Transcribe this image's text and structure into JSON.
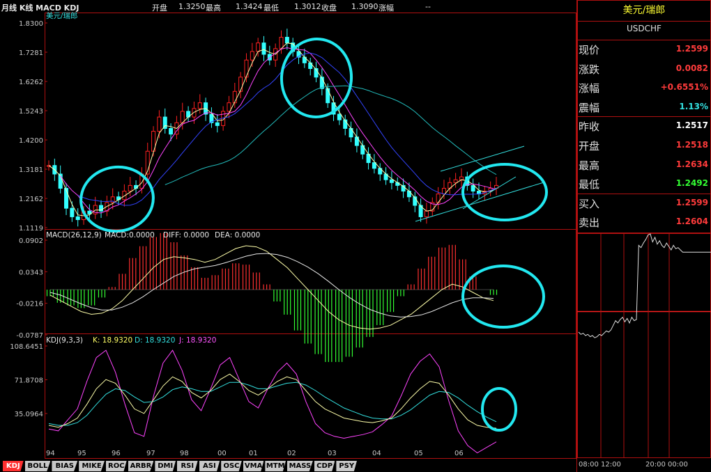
{
  "header": {
    "title": "月线 K线 MACD KDJ",
    "open_label": "开盘",
    "open_value": "1.3250",
    "high_label": "最高",
    "high_value": "1.3424",
    "low_label": "最低",
    "low_value": "1.3012",
    "close_label": "收盘",
    "close_value": "1.3090",
    "change_label": "涨幅",
    "change_value": "--"
  },
  "main_panel": {
    "symbol_label": "美元/瑞郎",
    "y_ticks": [
      "1.8300",
      "1.7281",
      "1.6262",
      "1.5243",
      "1.4200",
      "1.3181",
      "1.2162",
      "1.1119"
    ]
  },
  "macd_panel": {
    "title": "MACD(26,12,9)",
    "macd_label": "MACD:0.0000",
    "diff_label": "DIFF: 0.0000",
    "dea_label": "DEA: 0.0000",
    "y_ticks": [
      "0.0902",
      "0.0343",
      "-0.0216",
      "-0.0787"
    ]
  },
  "kdj_panel": {
    "title": "KDJ(9,3,3)",
    "k_label": "K: 18.9320",
    "d_label": "D: 18.9320",
    "j_label": "J: 18.9320",
    "y_ticks": [
      "108.6451",
      "71.8708",
      "35.0964"
    ]
  },
  "x_ticks": [
    "94",
    "95",
    "96",
    "97",
    "98",
    "00",
    "01",
    "02",
    "03",
    "04",
    "05",
    "06"
  ],
  "bottom_tabs": [
    "KDJ",
    "BOLL",
    "BIAS",
    "MIKE",
    "ROC",
    "ARBR",
    "DMI",
    "RSI",
    "ASI",
    "OSC",
    "VMA",
    "MTM",
    "MASS",
    "CDP",
    "PSY"
  ],
  "active_tab": "KDJ",
  "quote": {
    "name": "美元/瑞郎",
    "code": "USDCHF",
    "rows": [
      {
        "label": "现价",
        "value": "1.2599",
        "color": "#ff3b3b"
      },
      {
        "label": "涨跌",
        "value": "0.0082",
        "color": "#ff3b3b"
      },
      {
        "label": "涨幅",
        "value": "+0.6551%",
        "color": "#ff3b3b"
      },
      {
        "label": "震幅",
        "value": "1.13%",
        "color": "#33e0e0"
      },
      {
        "label": "昨收",
        "value": "1.2517",
        "color": "#ffffff"
      },
      {
        "label": "开盘",
        "value": "1.2518",
        "color": "#ff3b3b"
      },
      {
        "label": "最高",
        "value": "1.2634",
        "color": "#ff3b3b"
      },
      {
        "label": "最低",
        "value": "1.2492",
        "color": "#33ff33"
      },
      {
        "label": "买入",
        "value": "1.2599",
        "color": "#ff3b3b"
      },
      {
        "label": "卖出",
        "value": "1.2604",
        "color": "#ff3b3b"
      }
    ]
  },
  "intraday": {
    "time_start": "08:00",
    "time_mid1": "12:00",
    "time_mid2": "20:00",
    "time_end": "00:00",
    "ref_level": 0.32,
    "series": [
      0.14,
      0.12,
      0.13,
      0.11,
      0.12,
      0.1,
      0.11,
      0.09,
      0.1,
      0.12,
      0.11,
      0.13,
      0.15,
      0.14,
      0.16,
      0.2,
      0.24,
      0.22,
      0.25,
      0.27,
      0.23,
      0.26,
      0.22,
      0.27,
      0.24,
      0.25,
      0.9,
      0.88,
      0.92,
      0.95,
      0.99,
      1.0,
      0.93,
      0.97,
      0.91,
      0.94,
      0.9,
      0.88,
      0.92,
      0.89,
      0.86,
      0.9,
      0.87,
      0.88,
      0.86,
      0.84,
      0.84,
      0.84,
      0.84,
      0.84,
      0.84
    ]
  },
  "chart_data": {
    "type": "candlestick",
    "price_range": [
      1.1119,
      1.83
    ],
    "price_series": [
      1.33,
      1.3,
      1.25,
      1.18,
      1.15,
      1.14,
      1.17,
      1.16,
      1.19,
      1.17,
      1.2,
      1.22,
      1.21,
      1.24,
      1.26,
      1.25,
      1.3,
      1.38,
      1.45,
      1.5,
      1.46,
      1.44,
      1.48,
      1.52,
      1.5,
      1.53,
      1.55,
      1.51,
      1.48,
      1.47,
      1.52,
      1.55,
      1.59,
      1.64,
      1.7,
      1.73,
      1.76,
      1.72,
      1.7,
      1.74,
      1.78,
      1.76,
      1.73,
      1.71,
      1.69,
      1.67,
      1.64,
      1.6,
      1.55,
      1.51,
      1.49,
      1.46,
      1.43,
      1.4,
      1.37,
      1.34,
      1.32,
      1.3,
      1.28,
      1.27,
      1.26,
      1.24,
      1.22,
      1.19,
      1.15,
      1.17,
      1.2,
      1.23,
      1.25,
      1.27,
      1.28,
      1.29,
      1.26,
      1.24,
      1.23,
      1.24,
      1.25,
      1.26
    ],
    "macd": {
      "diff": [
        -0.01,
        -0.02,
        -0.03,
        -0.04,
        -0.045,
        -0.043,
        -0.035,
        -0.02,
        0.0,
        0.02,
        0.04,
        0.055,
        0.06,
        0.058,
        0.055,
        0.05,
        0.055,
        0.065,
        0.075,
        0.08,
        0.078,
        0.07,
        0.055,
        0.04,
        0.02,
        0.0,
        -0.02,
        -0.04,
        -0.055,
        -0.065,
        -0.07,
        -0.072,
        -0.07,
        -0.065,
        -0.055,
        -0.045,
        -0.03,
        -0.015,
        0.0,
        0.01,
        0.005,
        -0.005,
        -0.015,
        -0.02
      ],
      "dea": [
        -0.005,
        -0.01,
        -0.018,
        -0.026,
        -0.033,
        -0.037,
        -0.037,
        -0.032,
        -0.024,
        -0.013,
        0.0,
        0.012,
        0.024,
        0.032,
        0.038,
        0.041,
        0.044,
        0.049,
        0.055,
        0.061,
        0.065,
        0.066,
        0.064,
        0.059,
        0.051,
        0.041,
        0.029,
        0.015,
        0.0,
        -0.014,
        -0.026,
        -0.036,
        -0.043,
        -0.048,
        -0.05,
        -0.049,
        -0.046,
        -0.04,
        -0.032,
        -0.024,
        -0.018,
        -0.015,
        -0.015,
        -0.016
      ],
      "range": [
        -0.0787,
        0.0902
      ]
    },
    "kdj": {
      "k": [
        22,
        20,
        24,
        30,
        45,
        62,
        72,
        68,
        55,
        40,
        35,
        50,
        65,
        75,
        70,
        58,
        52,
        60,
        72,
        78,
        70,
        60,
        55,
        62,
        70,
        75,
        72,
        60,
        48,
        40,
        35,
        30,
        28,
        26,
        25,
        27,
        30,
        40,
        52,
        62,
        70,
        68,
        55,
        40,
        28,
        22,
        20,
        18.9
      ],
      "d": [
        24,
        22,
        22,
        25,
        33,
        45,
        56,
        62,
        60,
        53,
        47,
        48,
        53,
        61,
        64,
        62,
        59,
        59,
        64,
        69,
        69,
        66,
        62,
        62,
        65,
        68,
        69,
        66,
        60,
        53,
        47,
        41,
        37,
        33,
        30,
        29,
        29,
        33,
        39,
        47,
        55,
        59,
        58,
        52,
        44,
        37,
        31,
        26
      ],
      "j": [
        18,
        16,
        28,
        40,
        70,
        96,
        104,
        80,
        45,
        14,
        10,
        54,
        90,
        104,
        82,
        50,
        38,
        62,
        88,
        96,
        72,
        48,
        41,
        62,
        80,
        90,
        78,
        48,
        24,
        14,
        10,
        8,
        10,
        12,
        15,
        23,
        32,
        54,
        78,
        92,
        100,
        86,
        49,
        16,
        0,
        -8,
        -2,
        4
      ],
      "range": [
        0,
        108.6451
      ]
    }
  }
}
